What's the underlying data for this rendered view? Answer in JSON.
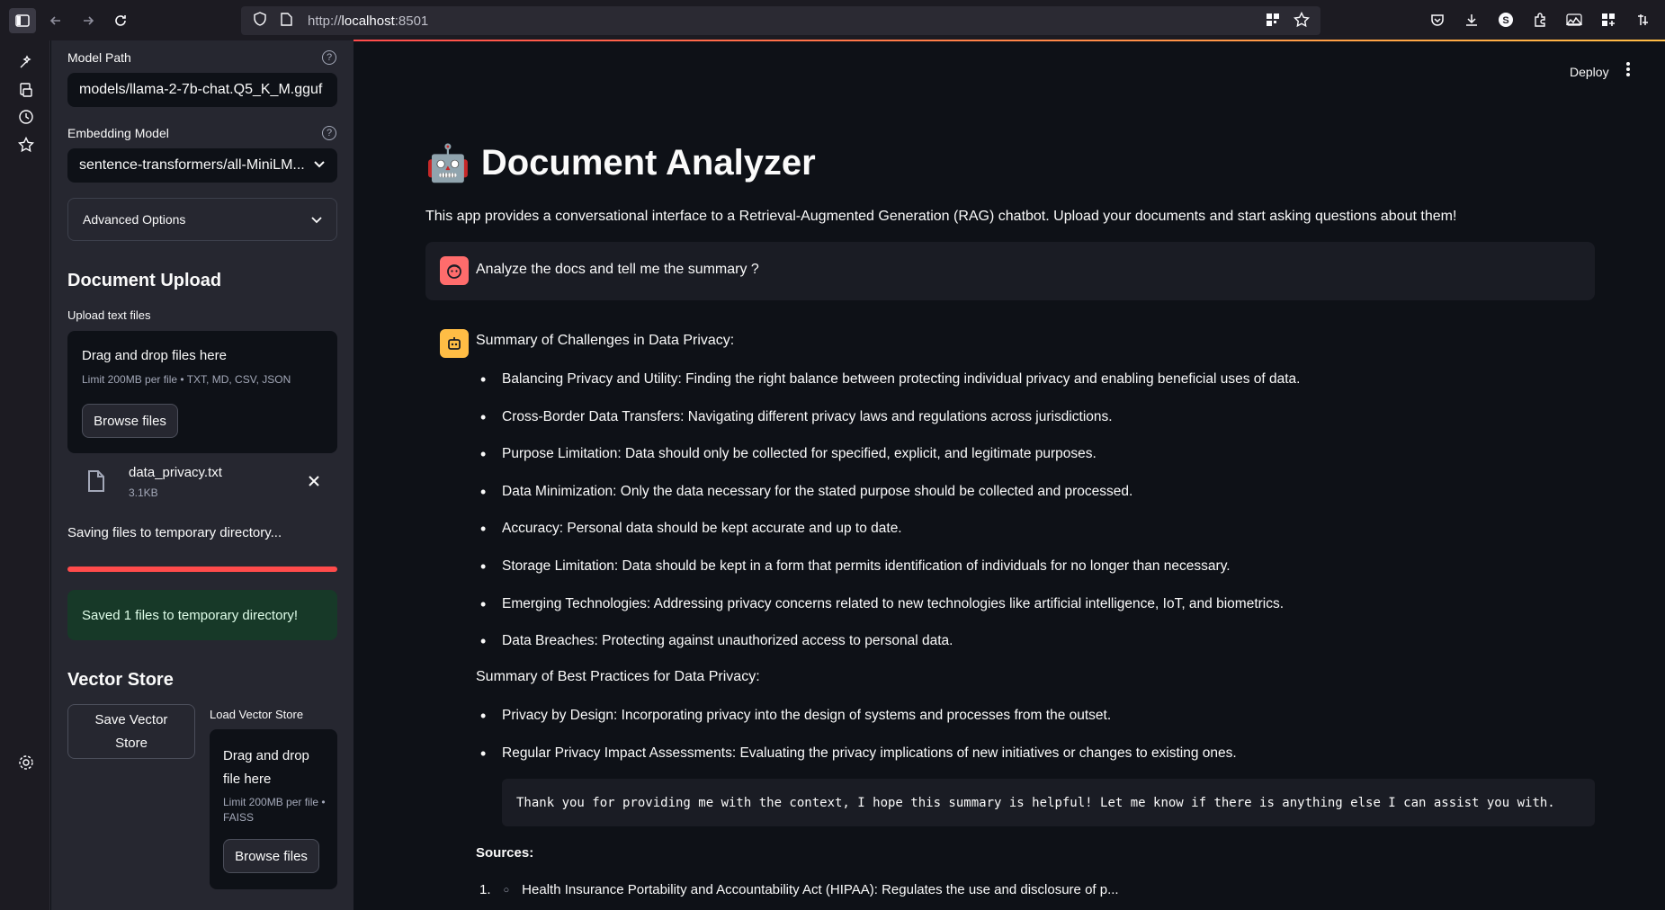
{
  "browser": {
    "url_protocol": "http://",
    "url_host": "localhost",
    "url_port": ":8501"
  },
  "sidebar": {
    "model_path_label": "Model Path",
    "model_path_value": "models/llama-2-7b-chat.Q5_K_M.gguf",
    "embedding_label": "Embedding Model",
    "embedding_value": "sentence-transformers/all-MiniLM...",
    "advanced_label": "Advanced Options",
    "doc_upload_heading": "Document Upload",
    "upload_label": "Upload text files",
    "dropzone_title": "Drag and drop files here",
    "dropzone_limit": "Limit 200MB per file • TXT, MD, CSV, JSON",
    "browse_label": "Browse files",
    "file_name": "data_privacy.txt",
    "file_size": "3.1KB",
    "saving_text": "Saving files to temporary directory...",
    "progress": 1.0,
    "success_text": "Saved 1 files to temporary directory!",
    "vector_heading": "Vector Store",
    "save_vector_label": "Save Vector Store",
    "load_vector_label": "Load Vector Store",
    "vs_dropzone_title": "Drag and drop file here",
    "vs_dropzone_limit": "Limit 200MB per file • FAISS",
    "vs_browse_label": "Browse files"
  },
  "header": {
    "deploy_label": "Deploy"
  },
  "main": {
    "title_emoji": "🤖",
    "title": "Document Analyzer",
    "intro": "This app provides a conversational interface to a Retrieval-Augmented Generation (RAG) chatbot. Upload your documents and start asking questions about them!",
    "user_message": "Analyze the docs and tell me the summary ?",
    "challenges_heading": "Summary of Challenges in Data Privacy:",
    "challenges": [
      "Balancing Privacy and Utility: Finding the right balance between protecting individual privacy and enabling beneficial uses of data.",
      "Cross-Border Data Transfers: Navigating different privacy laws and regulations across jurisdictions.",
      "Purpose Limitation: Data should only be collected for specified, explicit, and legitimate purposes.",
      "Data Minimization: Only the data necessary for the stated purpose should be collected and processed.",
      "Accuracy: Personal data should be kept accurate and up to date.",
      "Storage Limitation: Data should be kept in a form that permits identification of individuals for no longer than necessary.",
      "Emerging Technologies: Addressing privacy concerns related to new technologies like artificial intelligence, IoT, and biometrics.",
      "Data Breaches: Protecting against unauthorized access to personal data."
    ],
    "practices_heading": "Summary of Best Practices for Data Privacy:",
    "practices": [
      "Privacy by Design: Incorporating privacy into the design of systems and processes from the outset.",
      "Regular Privacy Impact Assessments: Evaluating the privacy implications of new initiatives or changes to existing ones."
    ],
    "code_text": "Thank you for providing me with the context, I hope this summary is helpful! Let me know if there is anything else I can assist you with.",
    "sources_label": "Sources:",
    "source_1_num": "1.",
    "source_1_text": "Health Insurance Portability and Accountability Act (HIPAA): Regulates the use and disclosure of p..."
  },
  "colors": {
    "accent": "#ff4b4b",
    "user_avatar": "#ff6c6c",
    "bot_avatar": "#ffbd45",
    "success_bg": "#173928"
  }
}
